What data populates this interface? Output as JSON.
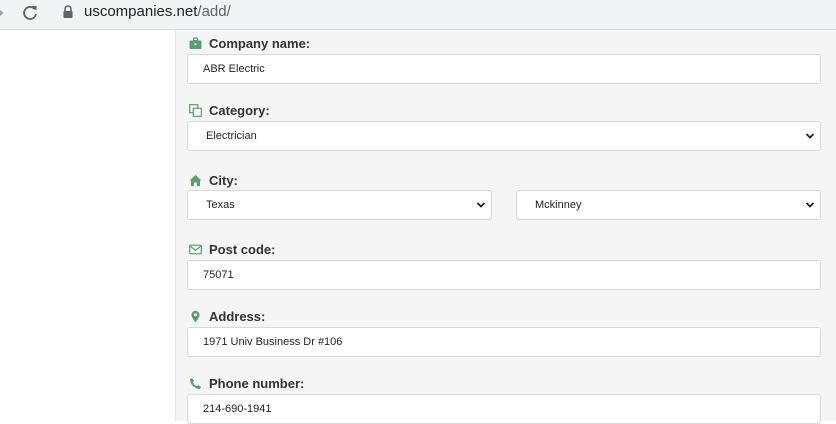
{
  "browser": {
    "url_domain": "uscompanies.net",
    "url_path": "/add/"
  },
  "form": {
    "company": {
      "label": "Company name:",
      "value": "ABR Electric",
      "icon": "briefcase-icon"
    },
    "category": {
      "label": "Category:",
      "value": "Electrician",
      "icon": "copy-icon"
    },
    "city": {
      "label": "City:",
      "state_value": "Texas",
      "city_value": "Mckinney",
      "icon": "home-icon"
    },
    "postcode": {
      "label": "Post code:",
      "value": "75071",
      "icon": "envelope-icon"
    },
    "address": {
      "label": "Address:",
      "value": "1971 Univ Business Dr #106",
      "icon": "map-marker-icon"
    },
    "phone": {
      "label": "Phone number:",
      "value": "214-690-1941",
      "icon": "phone-icon"
    }
  },
  "colors": {
    "icon_green": "#5a9e6f",
    "panel_bg": "#f5f5f5",
    "field_border": "#d8d8d8"
  }
}
